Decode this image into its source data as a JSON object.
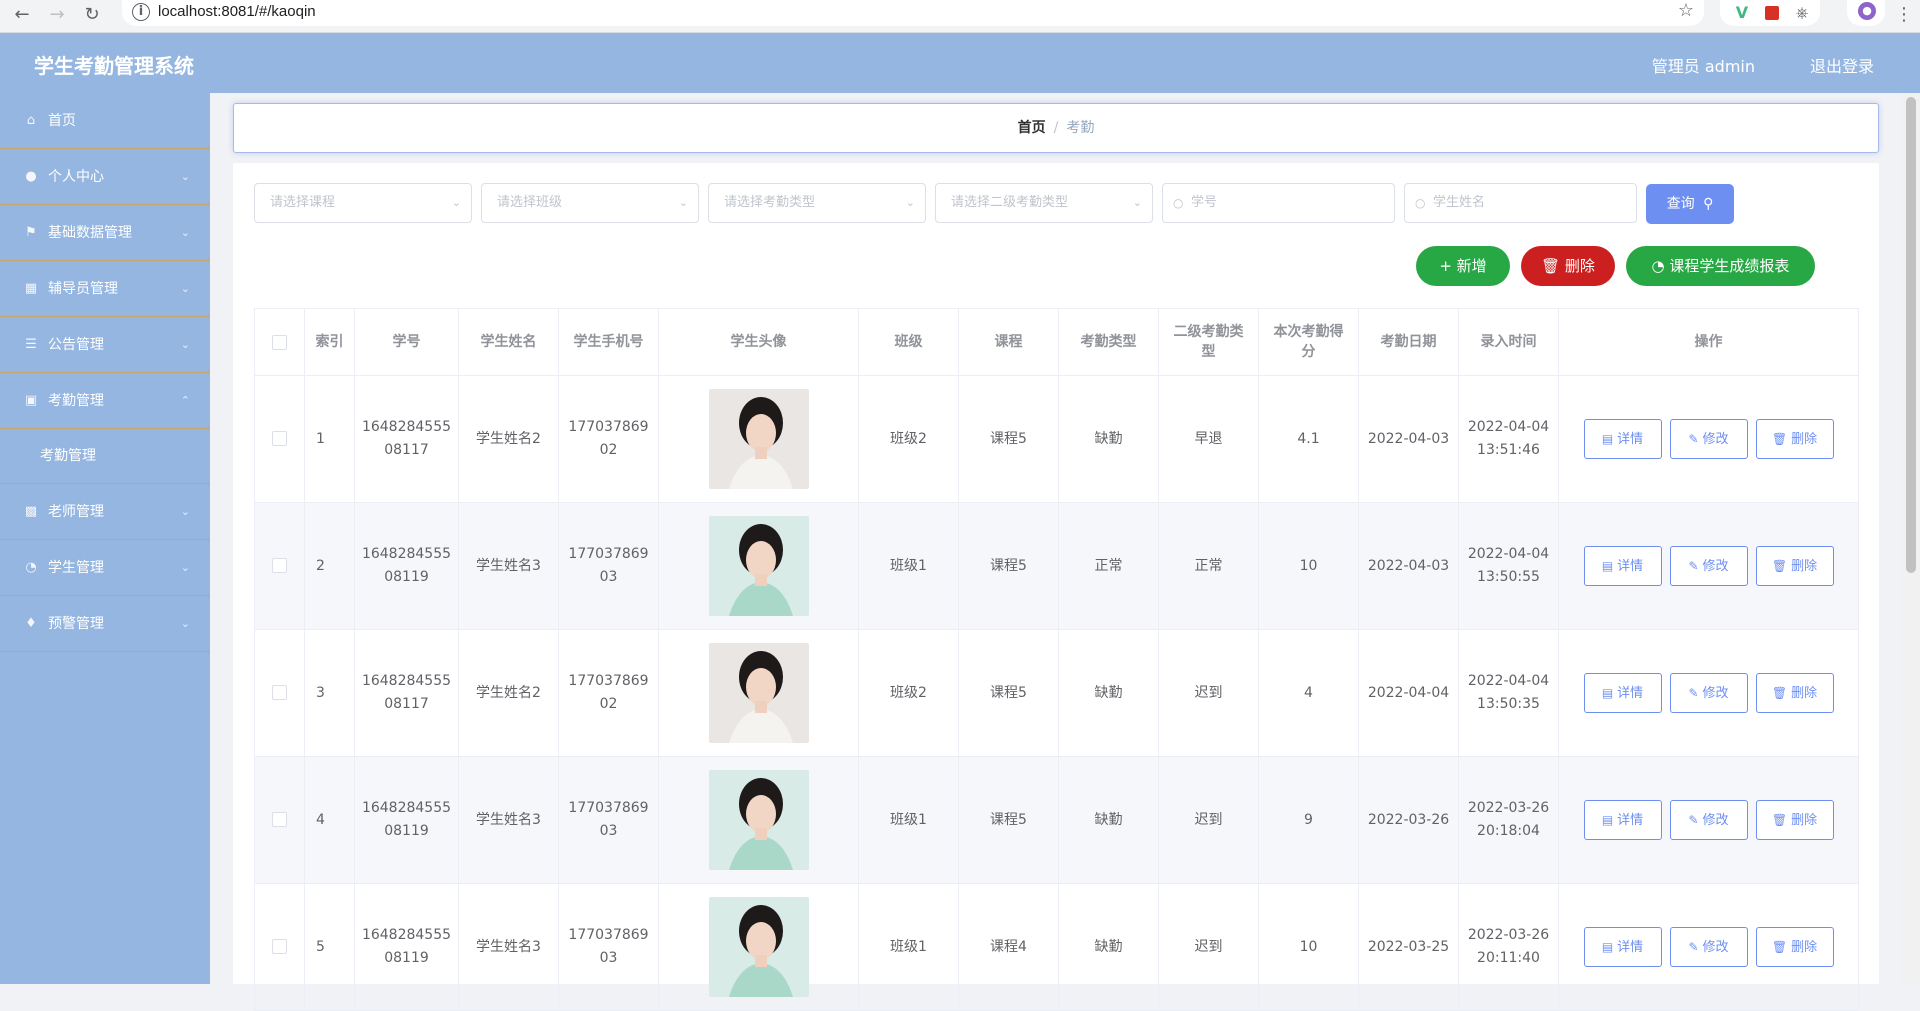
{
  "browser": {
    "url": "localhost:8081/#/kaoqin"
  },
  "header": {
    "title": "学生考勤管理系统",
    "user": "管理员 admin",
    "logout": "退出登录"
  },
  "sidebar": {
    "items": [
      {
        "label": "首页",
        "icon": "home-icon"
      },
      {
        "label": "个人中心",
        "icon": "user-icon"
      },
      {
        "label": "基础数据管理",
        "icon": "flag-icon"
      },
      {
        "label": "辅导员管理",
        "icon": "chart-line-icon"
      },
      {
        "label": "公告管理",
        "icon": "menu-icon"
      },
      {
        "label": "考勤管理",
        "icon": "cup-icon",
        "expanded": true,
        "sub": "考勤管理"
      },
      {
        "label": "老师管理",
        "icon": "bar-chart-icon"
      },
      {
        "label": "学生管理",
        "icon": "dashboard-icon"
      },
      {
        "label": "预警管理",
        "icon": "bell-icon"
      }
    ]
  },
  "breadcrumb": {
    "home": "首页",
    "separator": "/",
    "current": "考勤"
  },
  "filters": {
    "course": "请选择课程",
    "class": "请选择班级",
    "attendance_type": "请选择考勤类型",
    "sub_type": "请选择二级考勤类型",
    "student_no": "学号",
    "student_name": "学生姓名",
    "query": "查询"
  },
  "actions": {
    "add": "新增",
    "delete": "删除",
    "report": "课程学生成绩报表"
  },
  "table": {
    "headers": [
      "索引",
      "学号",
      "学生姓名",
      "学生手机号",
      "学生头像",
      "班级",
      "课程",
      "考勤类型",
      "二级考勤类型",
      "本次考勤得分",
      "考勤日期",
      "录入时间",
      "操作"
    ],
    "ops": {
      "detail": "详情",
      "edit": "修改",
      "delete": "删除"
    },
    "rows": [
      {
        "index": "1",
        "no_a": "1648284555",
        "no_b": "08117",
        "name": "学生姓名2",
        "phone_a": "177037869",
        "phone_b": "02",
        "cls": "班级2",
        "course": "课程5",
        "type": "缺勤",
        "sub": "早退",
        "score": "4.1",
        "date": "2022-04-03",
        "t_a": "2022-04-04",
        "t_b": "13:51:46"
      },
      {
        "index": "2",
        "no_a": "1648284555",
        "no_b": "08119",
        "name": "学生姓名3",
        "phone_a": "177037869",
        "phone_b": "03",
        "cls": "班级1",
        "course": "课程5",
        "type": "正常",
        "sub": "正常",
        "score": "10",
        "date": "2022-04-03",
        "t_a": "2022-04-04",
        "t_b": "13:50:55"
      },
      {
        "index": "3",
        "no_a": "1648284555",
        "no_b": "08117",
        "name": "学生姓名2",
        "phone_a": "177037869",
        "phone_b": "02",
        "cls": "班级2",
        "course": "课程5",
        "type": "缺勤",
        "sub": "迟到",
        "score": "4",
        "date": "2022-04-04",
        "t_a": "2022-04-04",
        "t_b": "13:50:35"
      },
      {
        "index": "4",
        "no_a": "1648284555",
        "no_b": "08119",
        "name": "学生姓名3",
        "phone_a": "177037869",
        "phone_b": "03",
        "cls": "班级1",
        "course": "课程5",
        "type": "缺勤",
        "sub": "迟到",
        "score": "9",
        "date": "2022-03-26",
        "t_a": "2022-03-26",
        "t_b": "20:18:04"
      },
      {
        "index": "5",
        "no_a": "1648284555",
        "no_b": "08119",
        "name": "学生姓名3",
        "phone_a": "177037869",
        "phone_b": "03",
        "cls": "班级1",
        "course": "课程4",
        "type": "缺勤",
        "sub": "迟到",
        "score": "10",
        "date": "2022-03-25",
        "t_a": "2022-03-26",
        "t_b": "20:11:40"
      }
    ]
  },
  "colors": {
    "header_bg": "#94b6e1",
    "primary": "#6d8ff2",
    "success": "#28a745",
    "danger": "#cc1f1f"
  }
}
